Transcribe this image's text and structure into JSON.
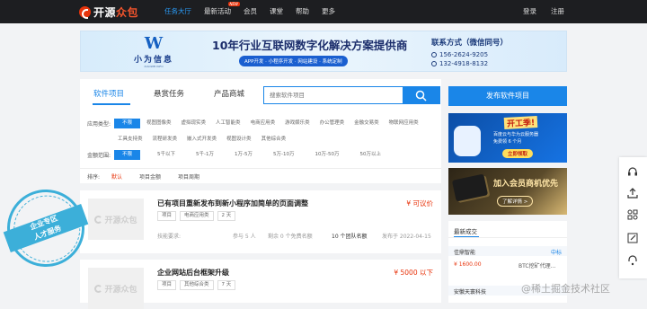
{
  "header": {
    "logo_main": "开源",
    "logo_accent": "众包",
    "nav": [
      {
        "label": "任务大厅",
        "active": true
      },
      {
        "label": "最新活动",
        "badge": "NEW"
      },
      {
        "label": "会员"
      },
      {
        "label": "课堂"
      },
      {
        "label": "帮助"
      },
      {
        "label": "更多"
      }
    ],
    "login": "登录",
    "register": "注册"
  },
  "banner": {
    "logo_mark": "W",
    "logo_cn": "小为信息",
    "logo_en": "XIAOWEI INFO",
    "title": "10年行业互联网数字化解决方案提供商",
    "chips": "APP开发 · 小程序开发 · 网站建设 · 系统定制",
    "contact_title": "联系方式（微信同号）",
    "phone1": "156-2624-9205",
    "phone2": "132-4918-8132"
  },
  "tabs": [
    {
      "label": "软件项目",
      "active": true
    },
    {
      "label": "悬赏任务"
    },
    {
      "label": "产品商城"
    }
  ],
  "search": {
    "placeholder": "搜索软件项目"
  },
  "filters": {
    "type_label": "应用类型:",
    "type_options": [
      "不限",
      "视图图像类",
      "虚拟现实类",
      "人工智能类",
      "电商应用类",
      "游戏娱乐类",
      "办公管理类",
      "金融交易类",
      "物联网应用类",
      "工具支持类",
      "流程研发类",
      "嵌入式开发类",
      "视图设计类",
      "其他综合类"
    ],
    "amount_label": "金额范围:",
    "amount_options": [
      "不限",
      "5千以下",
      "5千-1万",
      "1万-5万",
      "5万-10万",
      "10万-50万",
      "50万以上"
    ]
  },
  "sort": {
    "label": "排序:",
    "options": [
      "默认",
      "项目金额",
      "项目周期"
    ]
  },
  "projects": [
    {
      "thumb": "开源众包",
      "title": "已有项目重新发布到新小程序加简单的页面调整",
      "price": "¥ 可议价",
      "tags": [
        "项目",
        "电商应用类",
        "2 天"
      ],
      "skill_label": "技能要求:",
      "signed": "参与 5 人",
      "remain": "剩余 0 个免费名额",
      "team": "10 个团队名额",
      "date": "发布于  2022-04-15"
    },
    {
      "thumb": "开源众包",
      "title": "企业网站后台框架升级",
      "price": "¥ 5000 以下",
      "tags": [
        "项目",
        "其他综合类",
        "7 天"
      ]
    }
  ],
  "stamp": {
    "line1": "企业专区",
    "line2": "人才服务"
  },
  "sidebar": {
    "publish_button": "发布软件项目",
    "ad1": {
      "title": "开工季!",
      "line1": "百度云与华为云服务器",
      "line2": "免费领 6 个月",
      "button": "立即领取"
    },
    "ad2": {
      "title": "加入会员商机优先",
      "more": "了解详情 >"
    },
    "deals_title": "最新成交",
    "deals": [
      {
        "name": "佳鼎智能",
        "status": "中标",
        "price": "¥ 1600.00",
        "desc": "BTC挖矿代理..."
      },
      {
        "name": "安徽天寰科技",
        "status": ""
      }
    ]
  },
  "float_bar": [
    "headset-icon",
    "share-icon",
    "grid-icon",
    "edit-icon",
    "support-icon"
  ],
  "watermark": "@稀土掘金技术社区"
}
